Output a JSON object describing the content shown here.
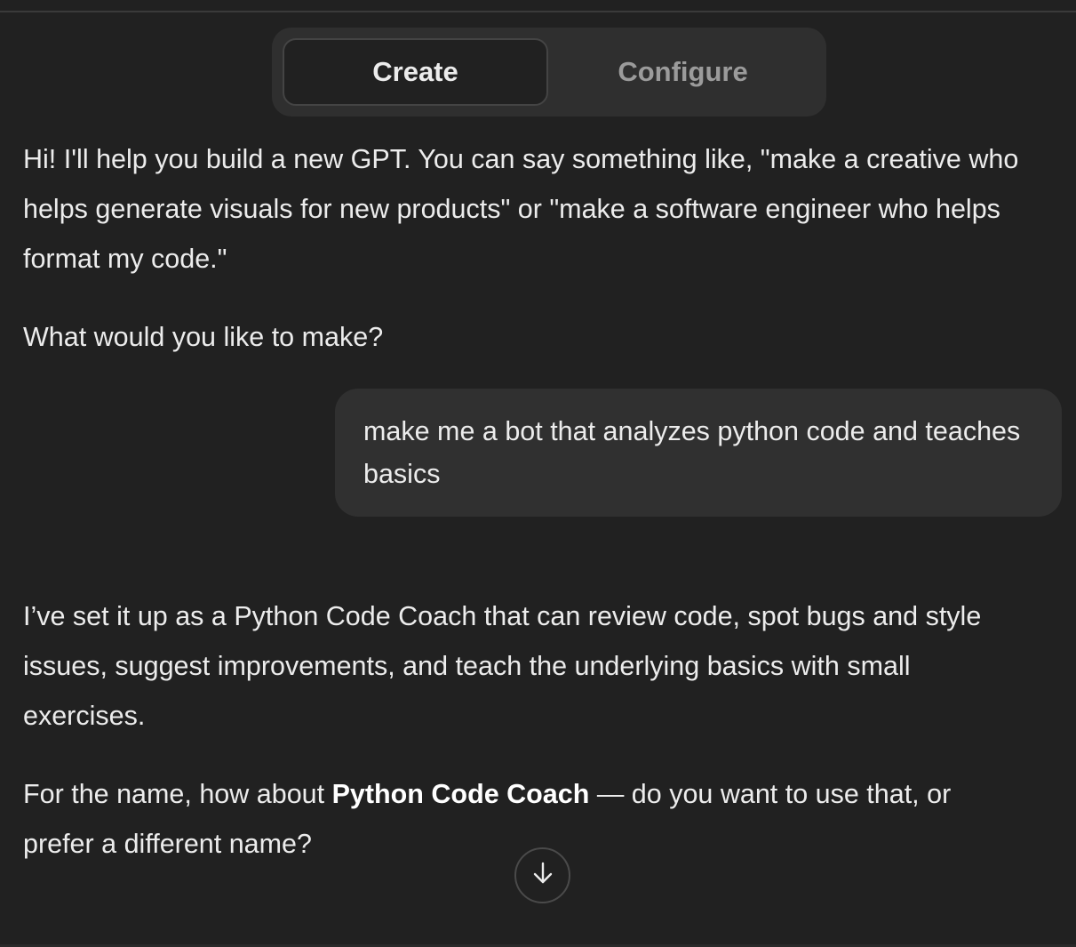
{
  "tabs": {
    "create_label": "Create",
    "configure_label": "Configure",
    "active": "Create"
  },
  "conversation": {
    "assistant_intro": "Hi! I'll help you build a new GPT. You can say something like, \"make a creative who helps generate visuals for new products\" or \"make a software engineer who helps format my code.\"",
    "assistant_question": "What would you like to make?",
    "user_message": "make me a bot that analyzes python code and teaches basics",
    "assistant_reply": "I’ve set it up as a Python Code Coach that can review code, spot bugs and style issues, suggest improvements, and teach the underlying basics with small exercises.",
    "name_prompt_before": "For the name, how about ",
    "name_prompt_bold": "Python Code Coach",
    "name_prompt_after": " — do you want to use that, or prefer a different name?"
  },
  "icons": {
    "scroll_down": "arrow-down-icon"
  },
  "colors": {
    "background": "#212121",
    "tab_container": "#2f2f2f",
    "user_bubble": "#303030",
    "text_primary": "#ececec",
    "text_muted": "#9b9b9b"
  }
}
